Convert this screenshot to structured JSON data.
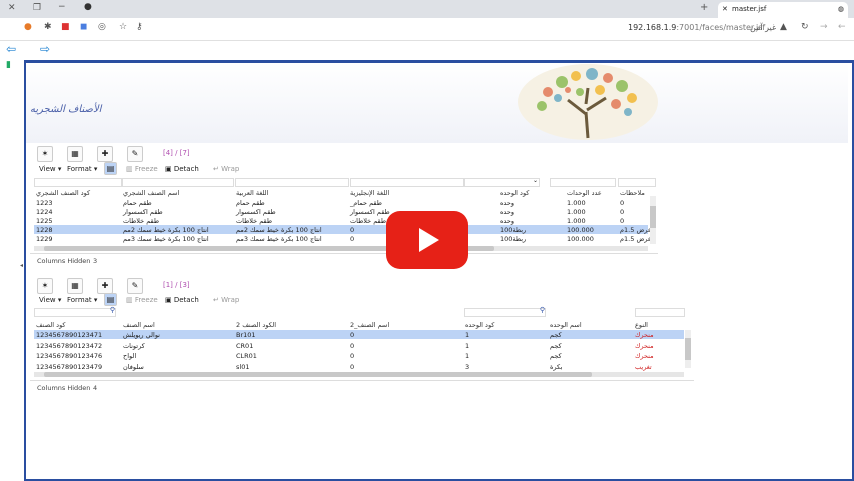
{
  "browser": {
    "tab_title": "master.jsf",
    "url_host": "192.168.1.9",
    "url_path": ":7001/faces/master.jsf",
    "security_label": "غير آمن"
  },
  "page": {
    "title": "الأصناف الشجريه"
  },
  "grid1": {
    "paging": "[4] / [7]",
    "menu_view": "View ▾",
    "menu_format": "Format ▾",
    "freeze_label": "Freeze",
    "detach_label": "Detach",
    "wrap_label": "Wrap",
    "headers": [
      "كود الصنف الشجري",
      "اسم الصنف الشجري",
      "اللغة العربية",
      "اللغة الإنجليزية",
      "كود الوحده",
      "عدد الوحدات",
      "ملاحظات"
    ],
    "rows": [
      [
        "1223",
        "طقم حمام",
        "طقم حمام",
        "_طقم حمام",
        "وحده",
        "1.000",
        "0"
      ],
      [
        "1224",
        "طقم اكسسوار",
        "طقم اكسسوار",
        "طقم اكسسوار",
        "وحده",
        "1.000",
        "0"
      ],
      [
        "1225",
        "طقم خلاطات",
        "طقم خلاطات",
        "طقم خلاطات",
        "وحده",
        "1.000",
        "0"
      ],
      [
        "1228",
        "انتاج 100 بكرة خيط سمك 2مم",
        "انتاج 100 بكرة خيط سمك 2مم",
        "0",
        "ربطة100",
        "100.000",
        "عرض 1.5م"
      ],
      [
        "1229",
        "انتاج 100 بكرة خيط سمك 3مم",
        "انتاج 100 بكرة خيط سمك 3مم",
        "0",
        "ربطة100",
        "100.000",
        "عرض 1.5م"
      ]
    ],
    "selected_row": 3,
    "footer_label": "Columns Hidden",
    "footer_count": "3"
  },
  "grid2": {
    "paging": "[1] / [3]",
    "menu_view": "View ▾",
    "menu_format": "Format ▾",
    "freeze_label": "Freeze",
    "detach_label": "Detach",
    "wrap_label": "Wrap",
    "headers": [
      "كود الصنف",
      "اسم الصنف",
      "الكود الصنف 2",
      "اسم الصنف_2",
      "كود الوحده",
      "اسم الوحده",
      "النوع"
    ],
    "rows": [
      [
        "1234567890123471",
        "نوالي ريويلش",
        "Br101",
        "0",
        "1",
        "كجم",
        "منحرك"
      ],
      [
        "1234567890123472",
        "كرتونات",
        "CR01",
        "0",
        "1",
        "كجم",
        "منحرك"
      ],
      [
        "1234567890123476",
        "الواح",
        "CLR01",
        "0",
        "1",
        "كجم",
        "منحرك"
      ],
      [
        "1234567890123479",
        "سلوفان",
        "sl01",
        "0",
        "3",
        "بكرة",
        "تغريب"
      ]
    ],
    "selected_row": 0,
    "footer_label": "Columns Hidden",
    "footer_count": "4"
  },
  "colors": {
    "accent": "#2a4ea0",
    "selected_row": "#bcd3f5",
    "youtube_red": "#e62117"
  }
}
